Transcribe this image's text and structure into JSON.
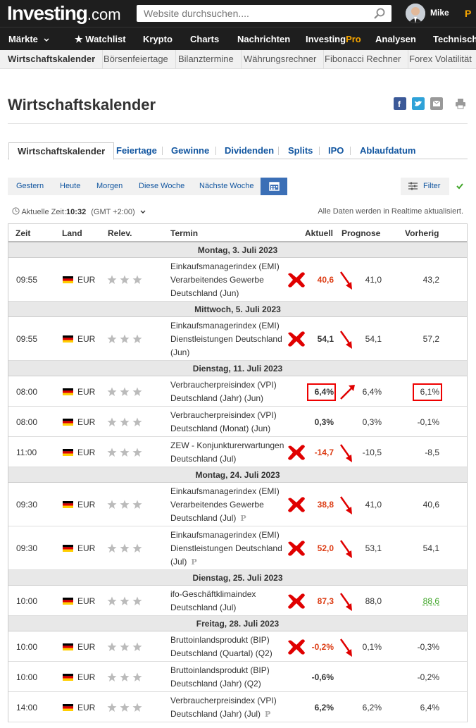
{
  "brand": {
    "logo_text": "Investing",
    "logo_suffix": ".com"
  },
  "search": {
    "placeholder": "Website durchsuchen...."
  },
  "user": {
    "name": "Mike"
  },
  "nav": {
    "items": [
      "Märkte",
      "Watchlist",
      "Krypto",
      "Charts",
      "Nachrichten",
      "InvestingPro",
      "Analysen",
      "Technisch"
    ]
  },
  "subnav": {
    "items": [
      "Wirtschaftskalender",
      "Börsenfeiertage",
      "Bilanztermine",
      "Währungsrechner",
      "Fibonacci Rechner",
      "Forex Volatilität"
    ]
  },
  "page": {
    "title": "Wirtschaftskalender"
  },
  "tabs": [
    "Wirtschaftskalender",
    "Feiertage",
    "Gewinne",
    "Dividenden",
    "Splits",
    "IPO",
    "Ablaufdatum"
  ],
  "datebar": {
    "buttons": [
      "Gestern",
      "Heute",
      "Morgen",
      "Diese Woche",
      "Nächste Woche"
    ],
    "filter_label": "Filter"
  },
  "timeinfo": {
    "label": "Aktuelle Zeit:",
    "time": "10:32",
    "tz": "(GMT +2:00)",
    "realtime": "Alle Daten werden in Realtime aktualisiert."
  },
  "table": {
    "headers": [
      "Zeit",
      "Land",
      "Relev.",
      "Termin",
      "Aktuell",
      "Prognose",
      "Vorherig"
    ],
    "days": [
      "Montag, 3. Juli 2023",
      "Mittwoch, 5. Juli 2023",
      "Dienstag, 11. Juli 2023",
      "Montag, 24. Juli 2023",
      "Dienstag, 25. Juli 2023",
      "Freitag, 28. Juli 2023"
    ],
    "rows": [
      {
        "time": "09:55",
        "cur": "EUR",
        "event": [
          "Einkaufsmanagerindex (EMI)",
          "Verarbeitendes Gewerbe",
          "Deutschland (Jun)"
        ],
        "actual": "40,6",
        "forecast": "41,0",
        "previous": "43,2"
      },
      {
        "time": "09:55",
        "cur": "EUR",
        "event": [
          "Einkaufsmanagerindex (EMI)",
          "Dienstleistungen Deutschland",
          "(Jun)"
        ],
        "actual": "54,1",
        "forecast": "54,1",
        "previous": "57,2"
      },
      {
        "time": "08:00",
        "cur": "EUR",
        "event": [
          "Verbraucherpreisindex (VPI)",
          "Deutschland (Jahr) (Jun)"
        ],
        "actual": "6,4%",
        "forecast": "6,4%",
        "previous": "6,1%"
      },
      {
        "time": "08:00",
        "cur": "EUR",
        "event": [
          "Verbraucherpreisindex (VPI)",
          "Deutschland (Monat) (Jun)"
        ],
        "actual": "0,3%",
        "forecast": "0,3%",
        "previous": "-0,1%"
      },
      {
        "time": "11:00",
        "cur": "EUR",
        "event": [
          "ZEW - Konjunkturerwartungen",
          "Deutschland (Jul)"
        ],
        "actual": "-14,7",
        "forecast": "-10,5",
        "previous": "-8,5"
      },
      {
        "time": "09:30",
        "cur": "EUR",
        "event": [
          "Einkaufsmanagerindex (EMI)",
          "Verarbeitendes Gewerbe",
          "Deutschland (Jul)"
        ],
        "actual": "38,8",
        "forecast": "41,0",
        "previous": "40,6"
      },
      {
        "time": "09:30",
        "cur": "EUR",
        "event": [
          "Einkaufsmanagerindex (EMI)",
          "Dienstleistungen Deutschland",
          "(Jul)"
        ],
        "actual": "52,0",
        "forecast": "53,1",
        "previous": "54,1"
      },
      {
        "time": "10:00",
        "cur": "EUR",
        "event": [
          "ifo-Geschäftklimaindex",
          "Deutschland (Jul)"
        ],
        "actual": "87,3",
        "forecast": "88,0",
        "previous": "88,6"
      },
      {
        "time": "10:00",
        "cur": "EUR",
        "event": [
          "Bruttoinlandsprodukt (BIP)",
          "Deutschland (Quartal) (Q2)"
        ],
        "actual": "-0,2%",
        "forecast": "0,1%",
        "previous": "-0,3%"
      },
      {
        "time": "10:00",
        "cur": "EUR",
        "event": [
          "Bruttoinlandsprodukt (BIP)",
          "Deutschland (Jahr) (Q2)"
        ],
        "actual": "-0,6%",
        "forecast": "",
        "previous": "-0,2%"
      },
      {
        "time": "14:00",
        "cur": "EUR",
        "event": [
          "Verbraucherpreisindex (VPI)",
          "Deutschland (Jahr) (Jul)"
        ],
        "actual": "6,2%",
        "forecast": "6,2%",
        "previous": "6,4%"
      }
    ]
  },
  "colors": {
    "negative": "#dc3c14",
    "positive": "#41a62a",
    "accent": "#1256a0",
    "annotation": "#e00000"
  }
}
